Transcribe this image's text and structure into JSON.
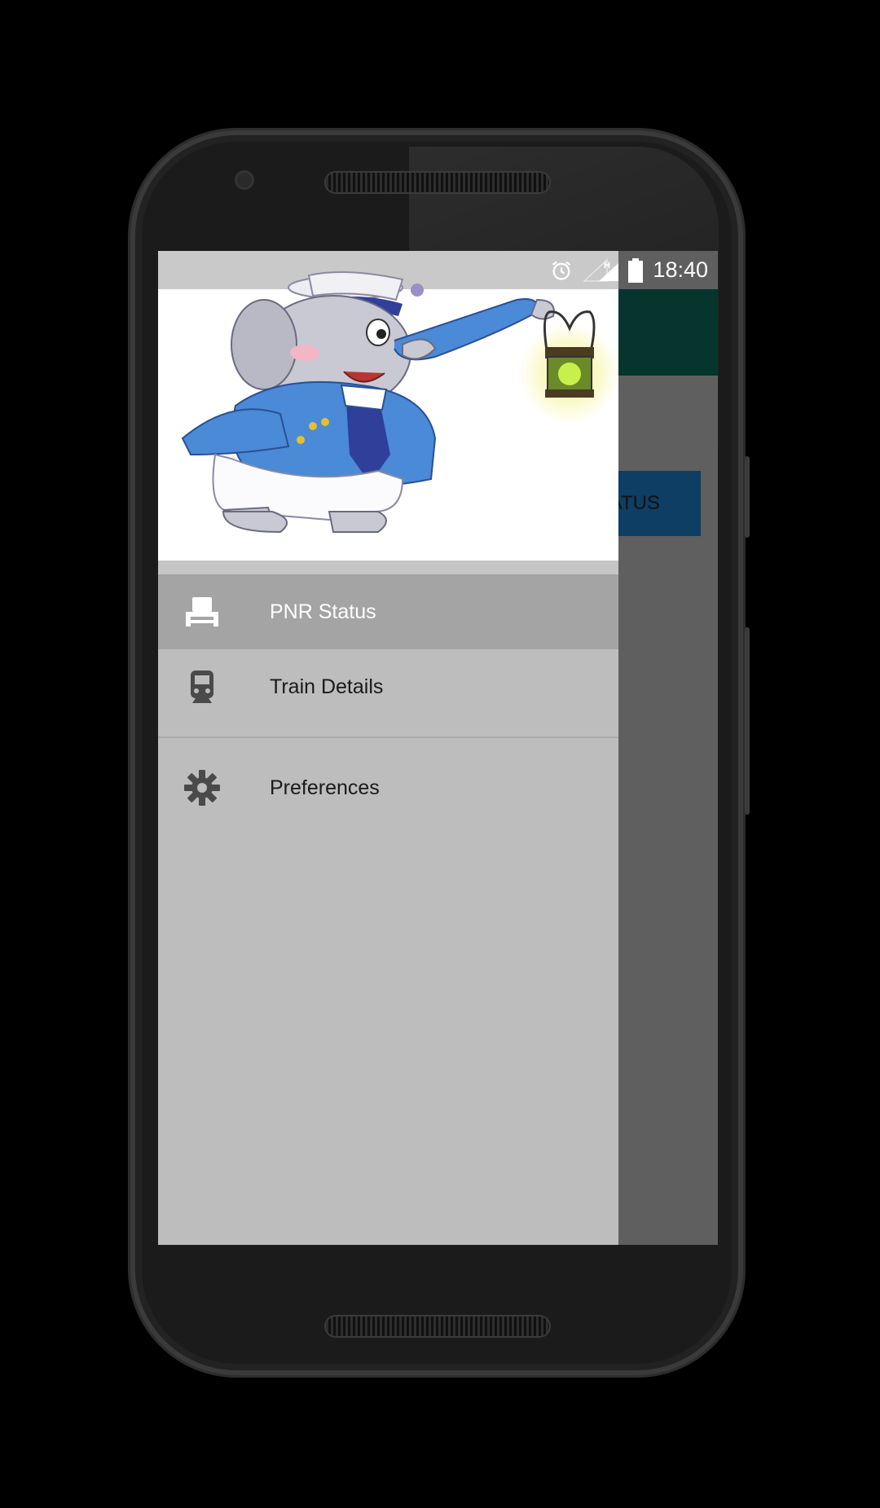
{
  "status_bar": {
    "time": "18:40",
    "icons": [
      "alarm-icon",
      "signal-icon",
      "battery-icon"
    ],
    "network_label": "H"
  },
  "background_app": {
    "button_partial_label": "ATUS",
    "toolbar_color": "#06352e",
    "button_color": "#0e3e63"
  },
  "drawer": {
    "header_image": "elephant-train-guard-illustration",
    "items": [
      {
        "label": "PNR Status",
        "icon": "seat-icon",
        "active": true
      },
      {
        "label": "Train Details",
        "icon": "train-icon",
        "active": false
      },
      {
        "label": "Preferences",
        "icon": "gear-icon",
        "active": false
      }
    ]
  }
}
